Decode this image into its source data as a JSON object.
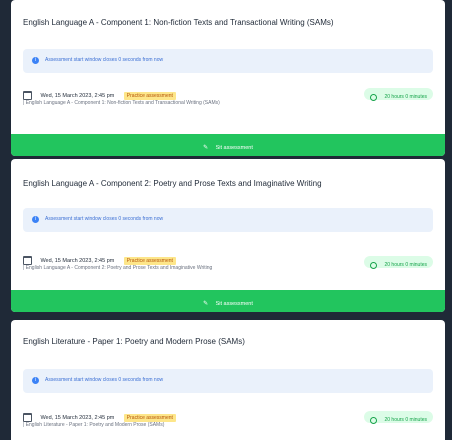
{
  "cards": [
    {
      "title": "English Language A - Component 1: Non-fiction Texts and Transactional Writing (SAMs)",
      "notice": "Assessment start window closes 0 seconds from now",
      "date": "Wed, 15 March 2023, 2:45 pm",
      "badge": "Practice assessment",
      "subtitle": "| English Language A - Component 1: Non-fiction Texts and Transactional Writing (SAMs)",
      "duration": "20 hours 0 minutes",
      "action": "Sit assessment"
    },
    {
      "title": "English Language A - Component 2: Poetry and Prose Texts and Imaginative Writing",
      "notice": "Assessment start window closes 0 seconds from now",
      "date": "Wed, 15 March 2023, 2:45 pm",
      "badge": "Practice assessment",
      "subtitle": "| English Language A - Component 2: Poetry and Prose Texts and Imaginative Writing",
      "duration": "20 hours 0 minutes",
      "action": "Sit assessment"
    },
    {
      "title": "English Literature - Paper 1: Poetry and Modern Prose (SAMs)",
      "notice": "Assessment start window closes 0 seconds from now",
      "date": "Wed, 15 March 2023, 2:45 pm",
      "badge": "Practice assessment",
      "subtitle": "| English Literature - Paper 1: Poetry and Modern Prose (SAMs)",
      "duration": "20 hours 0 minutes",
      "action": ""
    }
  ],
  "icons": {
    "notice": "info-icon",
    "date": "calendar-icon",
    "duration": "clock-icon",
    "action": "pencil-icon"
  },
  "colors": {
    "background": "#1f2937",
    "card": "#ffffff",
    "notice_bg": "#eaf1fb",
    "notice_text": "#3b6fd4",
    "badge_bg": "#fde68a",
    "duration_bg": "#dcfce7",
    "duration_text": "#16a34a",
    "action_bar": "#22c55e"
  }
}
